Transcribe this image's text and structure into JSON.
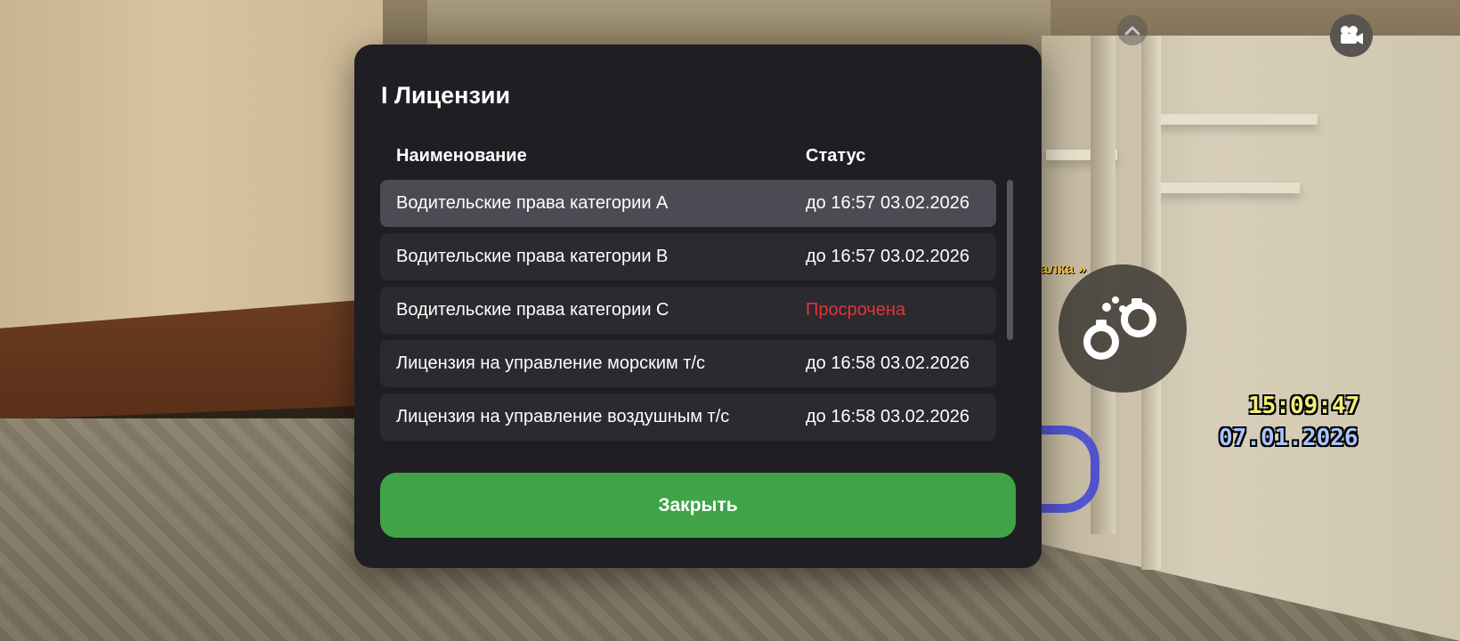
{
  "modal": {
    "title": "I Лицензии",
    "columns": {
      "name": "Наименование",
      "status": "Статус"
    },
    "rows": [
      {
        "name": "Водительские права категории A",
        "status": "до 16:57 03.02.2026"
      },
      {
        "name": "Водительские права категории B",
        "status": "до 16:57 03.02.2026"
      },
      {
        "name": "Водительские права категории C",
        "status": "Просрочена"
      },
      {
        "name": "Лицензия на управление морским т/с",
        "status": "до 16:58 03.02.2026"
      },
      {
        "name": "Лицензия на управление воздушным т/с",
        "status": "до 16:58 03.02.2026"
      }
    ],
    "close_label": "Закрыть"
  },
  "hud": {
    "time": "15:09:47",
    "date": "07.01.2026",
    "hint_fragment": "алка »",
    "icons": {
      "up": "chevron-up-icon",
      "camera": "video-camera-icon",
      "cuffs": "handcuffs-icon"
    }
  },
  "colors": {
    "modal_bg": "#1f1f23",
    "row_bg": "#2a2a2f",
    "row_selected_bg": "#4b4b53",
    "expired": "#e0343a",
    "close_button": "#41a348",
    "time_text": "#f4ec7a",
    "date_text": "#a9c4ff"
  }
}
